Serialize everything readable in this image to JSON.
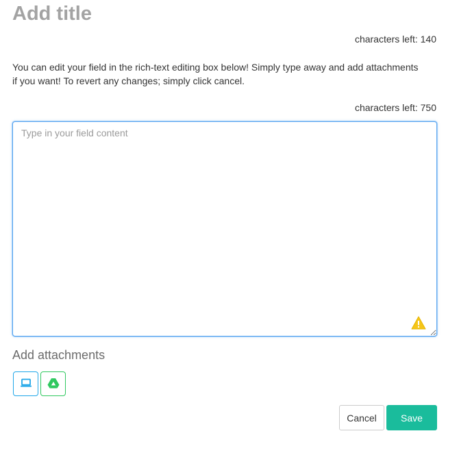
{
  "title": {
    "placeholder": "Add title",
    "value": "",
    "chars_left_label": "characters left: 140"
  },
  "instructions": "You can edit your field in the rich-text editing box below! Simply type away and add attachments if you want! To revert any changes; simply click cancel.",
  "content": {
    "chars_left_label": "characters left: 750",
    "placeholder": "Type in your field content",
    "value": "",
    "warning_icon": "warning-triangle-icon"
  },
  "attachments": {
    "heading": "Add attachments",
    "sources": [
      {
        "icon": "laptop-icon",
        "color": "#1fa6e8"
      },
      {
        "icon": "google-drive-icon",
        "color": "#2fc85f"
      }
    ]
  },
  "actions": {
    "cancel_label": "Cancel",
    "save_label": "Save",
    "save_color": "#1abc9c"
  }
}
